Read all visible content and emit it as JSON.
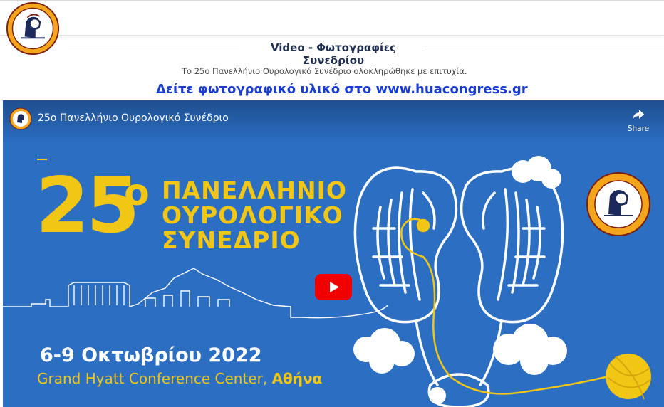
{
  "header": {
    "logo_text": "ΕΛΛΗΝΙΚΗ ΟΥΡΟΛΟΓΙΚΗ ΕΤΑΙΡΕΙΑ · HELLENIC UROLOGICAL ASSOCIATION",
    "logo_icon": "hellenic-urological-association-seal"
  },
  "section": {
    "title": "Video - Φωτογραφίες Συνεδρίου"
  },
  "intro": {
    "text": "Το 25ο Πανελλήνιο Ουρολογικό Συνέδριο ολοκληρώθηκε με επιτυχία."
  },
  "photo_link": {
    "text": "Δείτε φωτογραφικό υλικό στο www.huacongress.gr"
  },
  "video": {
    "title": "25ο Πανελλήνιο Ουρολογικό Συνέδριο",
    "share_label": "Share",
    "play_icon": "youtube-play-icon",
    "poster": {
      "number": "25",
      "superscript": "ο",
      "line1": "ΠΑΝΕΛΛΗΝΙΟ",
      "line2": "ΟΥΡΟΛΟΓΙΚΟ",
      "line3": "ΣΥΝΕΔΡΙΟ",
      "dates": "6-9 Οκτωβρίου 2022",
      "venue": "Grand Hyatt Conference Center, ",
      "city": "Αθήνα"
    }
  },
  "colors": {
    "video_bg": "#2b6ec2",
    "poster_yellow": "#f2c615",
    "link_blue": "#1a3dcf",
    "title_navy": "#1f2f4f",
    "youtube_red": "#f00000"
  }
}
